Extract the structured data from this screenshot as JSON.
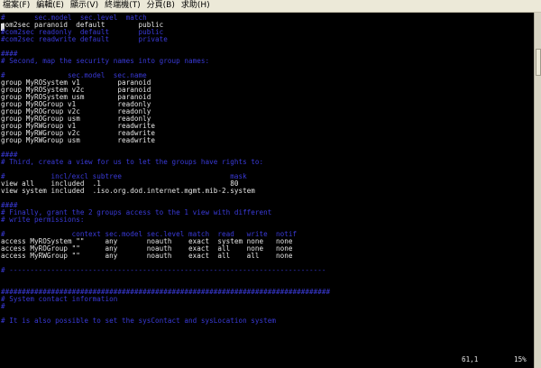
{
  "menubar": {
    "items": [
      "檔案(F)",
      "編輯(E)",
      "顯示(V)",
      "終端機(T)",
      "分頁(B)",
      "求助(H)"
    ]
  },
  "terminal": {
    "lines": [
      {
        "text": "#       sec.model  sec.level  match",
        "color": "blue"
      },
      {
        "text": "com2sec paranoid  default        public",
        "color": "white"
      },
      {
        "text": "#com2sec readonly  default       public",
        "color": "blue"
      },
      {
        "text": "#com2sec readwrite default       private",
        "color": "blue"
      },
      {
        "text": "",
        "color": "white"
      },
      {
        "text": "####",
        "color": "blue"
      },
      {
        "text": "# Second, map the security names into group names:",
        "color": "blue"
      },
      {
        "text": "",
        "color": "white"
      },
      {
        "text": "#               sec.model  sec.name",
        "color": "blue"
      },
      {
        "text": "group MyROSystem v1         paranoid",
        "color": "white"
      },
      {
        "text": "group MyROSystem v2c        paranoid",
        "color": "white"
      },
      {
        "text": "group MyROSystem usm        paranoid",
        "color": "white"
      },
      {
        "text": "group MyROGroup v1          readonly",
        "color": "white"
      },
      {
        "text": "group MyROGroup v2c         readonly",
        "color": "white"
      },
      {
        "text": "group MyROGroup usm         readonly",
        "color": "white"
      },
      {
        "text": "group MyRWGroup v1          readwrite",
        "color": "white"
      },
      {
        "text": "group MyRWGroup v2c         readwrite",
        "color": "white"
      },
      {
        "text": "group MyRWGroup usm         readwrite",
        "color": "white"
      },
      {
        "text": "",
        "color": "white"
      },
      {
        "text": "####",
        "color": "blue"
      },
      {
        "text": "# Third, create a view for us to let the groups have rights to:",
        "color": "blue"
      },
      {
        "text": "",
        "color": "white"
      },
      {
        "text": "#           incl/excl subtree                          mask",
        "color": "blue"
      },
      {
        "text": "view all    included  .1                               80",
        "color": "white"
      },
      {
        "text": "view system included  .iso.org.dod.internet.mgmt.mib-2.system",
        "color": "white"
      },
      {
        "text": "",
        "color": "white"
      },
      {
        "text": "####",
        "color": "blue"
      },
      {
        "text": "# Finally, grant the 2 groups access to the 1 view with different",
        "color": "blue"
      },
      {
        "text": "# write permissions:",
        "color": "blue"
      },
      {
        "text": "",
        "color": "white"
      },
      {
        "text": "#                context sec.model sec.level match  read   write  notif",
        "color": "blue"
      },
      {
        "text": "access MyROSystem \"\"     any       noauth    exact  system none   none",
        "color": "white"
      },
      {
        "text": "access MyROGroup \"\"      any       noauth    exact  all    none   none",
        "color": "white"
      },
      {
        "text": "access MyRWGroup \"\"      any       noauth    exact  all    all    none",
        "color": "white"
      },
      {
        "text": "",
        "color": "white"
      },
      {
        "text": "# ----------------------------------------------------------------------------",
        "color": "blue"
      },
      {
        "text": "",
        "color": "white"
      },
      {
        "text": "",
        "color": "white"
      },
      {
        "text": "###############################################################################",
        "color": "blue"
      },
      {
        "text": "# System contact information",
        "color": "blue"
      },
      {
        "text": "#",
        "color": "blue"
      },
      {
        "text": "",
        "color": "white"
      },
      {
        "text": "# It is also possible to set the sysContact and sysLocation system",
        "color": "blue"
      }
    ]
  },
  "status": {
    "position": "61,1",
    "percent": "15%"
  }
}
